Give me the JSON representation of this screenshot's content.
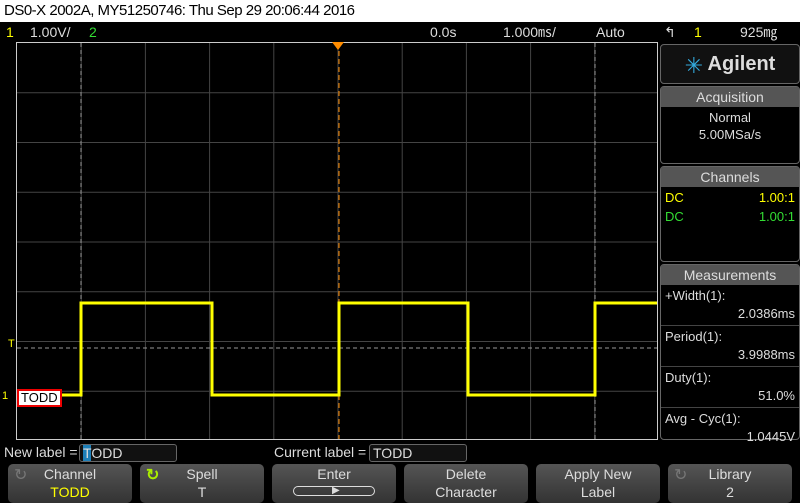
{
  "title": "DS0-X 2002A, MY51250746: Thu Sep 29 20:06:44 2016",
  "status": {
    "ch1": "1",
    "ch1_scale": "1.00V/",
    "ch2": "2",
    "time_offset": "0.0s",
    "time_scale": "1.000㎳/",
    "trigger_mode": "Auto",
    "trigger_icon": "rising-edge-icon",
    "trigger_source": "1",
    "trigger_level": "925㎎"
  },
  "colors": {
    "ch1": "#ffff00",
    "ch2": "#33dd33",
    "trigger": "#ff8c00",
    "brand": "#33aadd"
  },
  "brand": "Agilent",
  "acquisition": {
    "header": "Acquisition",
    "mode": "Normal",
    "rate": "5.00MSa/s"
  },
  "channels": {
    "header": "Channels",
    "items": [
      {
        "coupling": "DC",
        "ratio": "1.00:1"
      },
      {
        "coupling": "DC",
        "ratio": "1.00:1"
      }
    ]
  },
  "measurements": {
    "header": "Measurements",
    "items": [
      {
        "label": "+Width(1):",
        "value": "2.0386ms"
      },
      {
        "label": "Period(1):",
        "value": "3.9988ms"
      },
      {
        "label": "Duty(1):",
        "value": "51.0%"
      },
      {
        "label": "Avg - Cyc(1):",
        "value": "1.0445V"
      }
    ]
  },
  "channel_label": "TODD",
  "markers": {
    "trigger_level": "T",
    "ground": "1"
  },
  "label_editor": {
    "new_label_text": "New label =",
    "new_label_cursor": "T",
    "new_label_rest": "ODD",
    "current_label_text": "Current label =",
    "current_label": "TODD"
  },
  "softkeys": [
    {
      "top": "Channel",
      "bottom": "TODD"
    },
    {
      "top": "Spell",
      "bottom": "T"
    },
    {
      "top": "Enter",
      "bottom": ""
    },
    {
      "top": "Delete",
      "bottom": "Character"
    },
    {
      "top": "Apply New",
      "bottom": "Label"
    },
    {
      "top": "Library",
      "bottom": "2"
    }
  ]
}
